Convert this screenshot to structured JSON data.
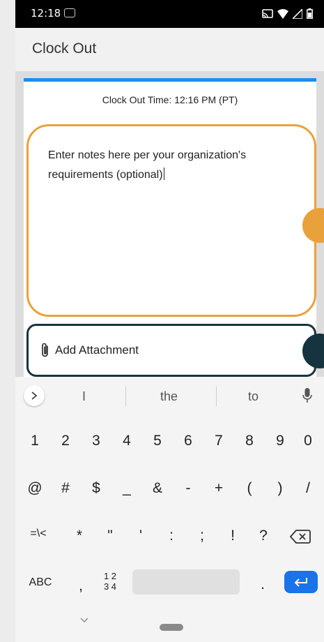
{
  "status_bar": {
    "time": "12:18",
    "icons": [
      "sim-icon",
      "cast-icon",
      "wifi-icon",
      "signal-icon",
      "battery-icon"
    ]
  },
  "app_bar": {
    "title": "Clock Out"
  },
  "clock_out": {
    "time_label": "Clock Out Time: 12:16 PM (PT)"
  },
  "notes": {
    "text": "Enter notes here per your organization's requirements (optional)"
  },
  "attachment": {
    "label": "Add Attachment",
    "icon": "paperclip-icon"
  },
  "keyboard": {
    "suggestions": [
      "I",
      "the",
      "to"
    ],
    "row_numbers": [
      "1",
      "2",
      "3",
      "4",
      "5",
      "6",
      "7",
      "8",
      "9",
      "0"
    ],
    "row_symbols1": [
      "@",
      "#",
      "$",
      "_",
      "&",
      "-",
      "+",
      "(",
      ")",
      "/"
    ],
    "row_symbols2": [
      "=\\<",
      "*",
      "\"",
      "'",
      ":",
      ";",
      "!",
      "?"
    ],
    "mode_label": "ABC",
    "comma": ",",
    "numpad_label_top": "1 2",
    "numpad_label_bottom": "3 4",
    "period": "."
  },
  "colors": {
    "accent_blue": "#1c8cf2",
    "notes_border": "#e9a13b",
    "attach_border": "#16343f",
    "enter_key": "#1a73e8"
  }
}
